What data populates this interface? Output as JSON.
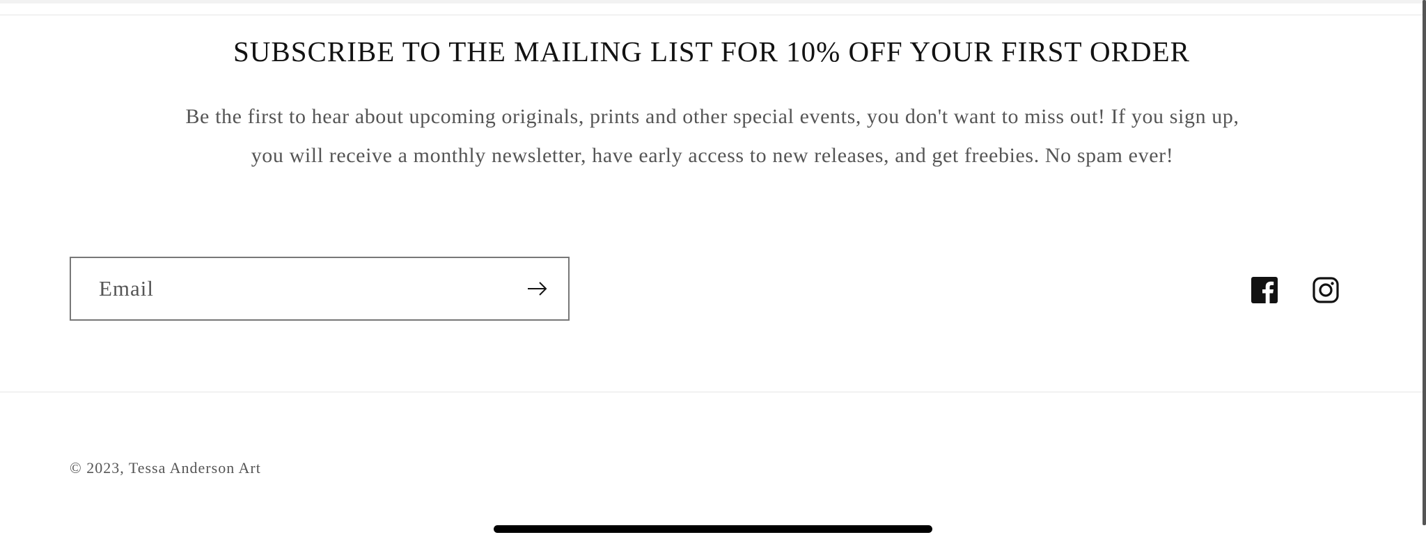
{
  "newsletter": {
    "heading": "SUBSCRIBE TO THE MAILING LIST FOR 10% OFF YOUR FIRST ORDER",
    "description": "Be the first to hear about upcoming originals, prints and other special events, you don't want to miss out! If you sign up, you will receive a monthly newsletter, have early access to new releases, and get freebies. No spam ever!",
    "email_placeholder": "Email",
    "email_value": "",
    "submit_icon": "arrow-right-icon"
  },
  "social": {
    "facebook_icon": "facebook-icon",
    "instagram_icon": "instagram-icon"
  },
  "footer": {
    "copyright": "© 2023, Tessa Anderson Art"
  },
  "colors": {
    "heading": "#121212",
    "body_text": "#555555",
    "border": "#777777",
    "icon": "#121212"
  }
}
